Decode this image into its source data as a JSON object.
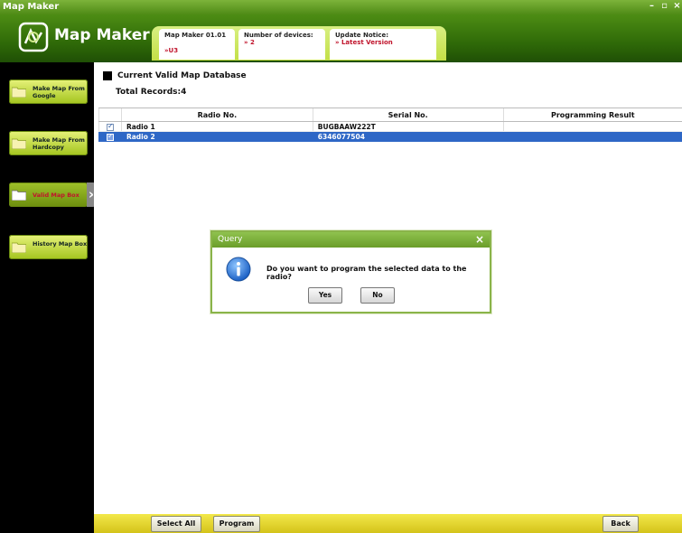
{
  "window": {
    "title": "Map Maker",
    "controls": [
      "minimize-icon",
      "restore-icon",
      "close-icon"
    ]
  },
  "header": {
    "app_name": "Map Maker",
    "info": {
      "version_label": "Map Maker 01.01",
      "version_value": "»U3",
      "devices_label": "Number of devices:",
      "devices_value": "» 2",
      "update_label": "Update Notice:",
      "update_value": "» Latest Version"
    }
  },
  "sidebar": {
    "items": [
      {
        "label": "Make Map From Google",
        "icon": "folder-icon",
        "active": false
      },
      {
        "label": "Make Map From Hardcopy",
        "icon": "folder-icon",
        "active": false
      },
      {
        "label": "Valid Map Box",
        "icon": "folder-icon",
        "active": true
      },
      {
        "label": "History Map Box",
        "icon": "folder-icon",
        "active": false
      }
    ]
  },
  "main": {
    "title": "Current Valid Map Database",
    "total_label": "Total Records:4",
    "columns": [
      "Radio No.",
      "Serial No.",
      "Programming Result"
    ],
    "rows": [
      {
        "checked": true,
        "radio": "Radio 1",
        "serial": "BUGBAAW222T",
        "result": "",
        "selected": false
      },
      {
        "checked": true,
        "radio": "Radio 2",
        "serial": "634607750​4",
        "result": "",
        "selected": true
      }
    ]
  },
  "dialog": {
    "title": "Query",
    "message": "Do you want to program the selected data to the radio?",
    "icon": "info-icon",
    "yes_label": "Yes",
    "no_label": "No"
  },
  "bottombar": {
    "select_all": "Select All",
    "program": "Program",
    "back": "Back"
  },
  "colors": {
    "brand_green": "#4d8d14",
    "accent_yellow": "#e6f27a",
    "selection_blue": "#2e67c6",
    "value_red": "#c0142c"
  }
}
